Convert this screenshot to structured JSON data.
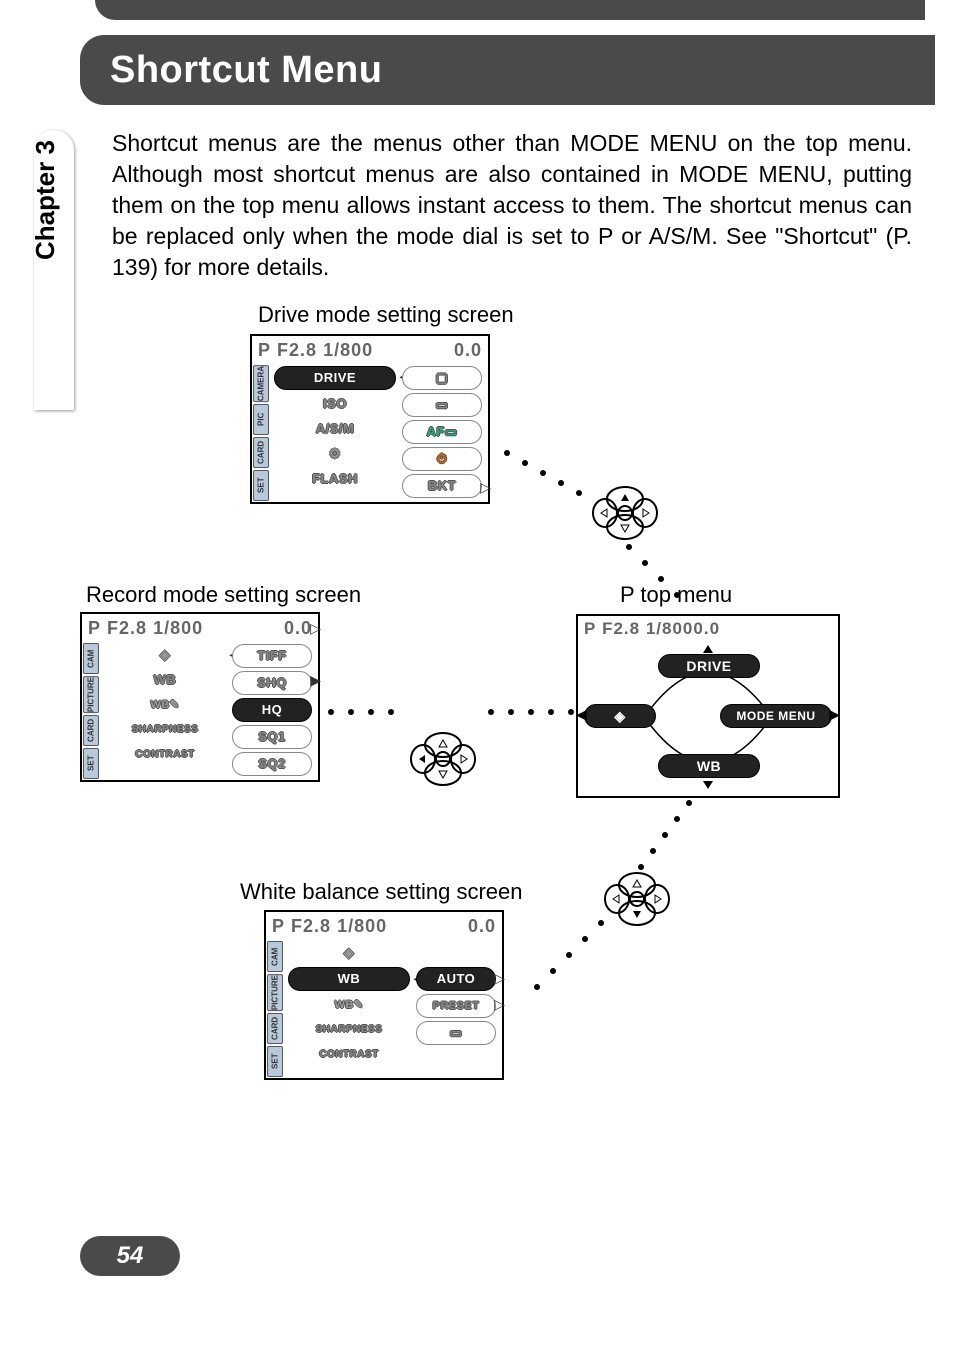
{
  "page": {
    "title": "Shortcut Menu",
    "chapter": "Chapter 3",
    "body_text": "Shortcut menus are the menus other than MODE MENU on the top menu. Although most shortcut menus are also contained in MODE MENU, putting them on the top menu allows instant access to them. The shortcut menus can be replaced only when the mode dial is set to P or A/S/M. See \"Shortcut\" (P. 139) for more details.",
    "page_number": "54"
  },
  "captions": {
    "drive": "Drive mode setting screen",
    "record": "Record mode setting screen",
    "ptop": "P top menu",
    "wb": "White balance setting screen"
  },
  "status": {
    "mode": "P",
    "aperture": "F2.8",
    "shutter": "1/800",
    "exp": "0.0"
  },
  "drive_screen": {
    "tabs": [
      "CAMERA",
      "PIC",
      "CARD",
      "SET"
    ],
    "items": [
      "DRIVE",
      "ISO",
      "A/S/M",
      "⚙",
      "FLASH"
    ],
    "values": [
      "▢",
      "▭",
      "AF▭",
      "⏱",
      "BKT"
    ],
    "selected_index": 0
  },
  "record_screen": {
    "tabs": [
      "CAM",
      "PICTURE",
      "CARD",
      "SET"
    ],
    "items": [
      "◈",
      "WB",
      "WB✎",
      "SHARPNESS",
      "CONTRAST"
    ],
    "values": [
      "TIFF",
      "SHQ",
      "HQ",
      "SQ1",
      "SQ2"
    ],
    "selected_index": 2
  },
  "wb_screen": {
    "tabs": [
      "CAM",
      "PICTURE",
      "CARD",
      "SET"
    ],
    "items": [
      "◈",
      "WB",
      "WB✎",
      "SHARPNESS",
      "CONTRAST"
    ],
    "values": [
      "",
      "AUTO",
      "PRESET",
      "▭",
      ""
    ],
    "selected_index": 1
  },
  "topmenu": {
    "up": "DRIVE",
    "left": "◈",
    "right": "MODE MENU",
    "down": "WB"
  }
}
